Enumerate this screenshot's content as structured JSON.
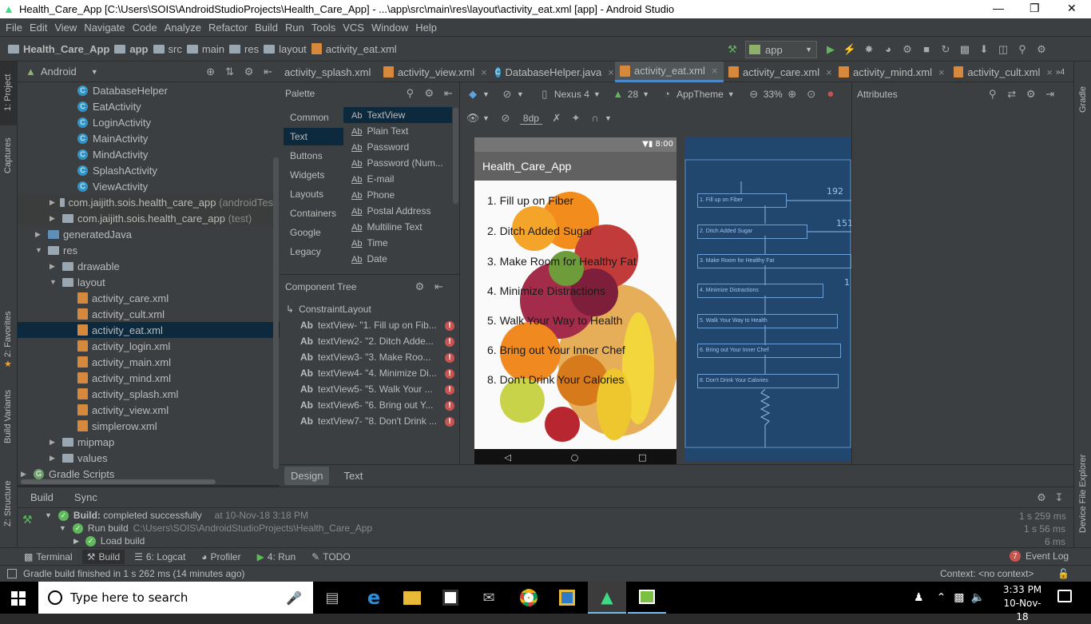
{
  "window": {
    "title": "Health_Care_App [C:\\Users\\SOIS\\AndroidStudioProjects\\Health_Care_App] - ...\\app\\src\\main\\res\\layout\\activity_eat.xml [app] - Android Studio"
  },
  "menu": [
    "File",
    "Edit",
    "View",
    "Navigate",
    "Code",
    "Analyze",
    "Refactor",
    "Build",
    "Run",
    "Tools",
    "VCS",
    "Window",
    "Help"
  ],
  "breadcrumbs": [
    "Health_Care_App",
    "app",
    "src",
    "main",
    "res",
    "layout",
    "activity_eat.xml"
  ],
  "run_config": "app",
  "project": {
    "view_mode": "Android",
    "items": [
      {
        "label": "DatabaseHelper",
        "kind": "class"
      },
      {
        "label": "EatActivity",
        "kind": "class"
      },
      {
        "label": "LoginActivity",
        "kind": "class"
      },
      {
        "label": "MainActivity",
        "kind": "class"
      },
      {
        "label": "MindActivity",
        "kind": "class"
      },
      {
        "label": "SplashActivity",
        "kind": "class"
      },
      {
        "label": "ViewActivity",
        "kind": "class"
      },
      {
        "label": "com.jaijith.sois.health_care_app",
        "suffix": "(androidTest)",
        "kind": "pkg"
      },
      {
        "label": "com.jaijith.sois.health_care_app",
        "suffix": "(test)",
        "kind": "pkg"
      },
      {
        "label": "generatedJava",
        "kind": "folder"
      },
      {
        "label": "res",
        "kind": "folder"
      },
      {
        "label": "drawable",
        "kind": "folder"
      },
      {
        "label": "layout",
        "kind": "folder"
      },
      {
        "label": "activity_care.xml",
        "kind": "xml"
      },
      {
        "label": "activity_cult.xml",
        "kind": "xml"
      },
      {
        "label": "activity_eat.xml",
        "kind": "xml"
      },
      {
        "label": "activity_login.xml",
        "kind": "xml"
      },
      {
        "label": "activity_main.xml",
        "kind": "xml"
      },
      {
        "label": "activity_mind.xml",
        "kind": "xml"
      },
      {
        "label": "activity_splash.xml",
        "kind": "xml"
      },
      {
        "label": "activity_view.xml",
        "kind": "xml"
      },
      {
        "label": "simplerow.xml",
        "kind": "xml"
      },
      {
        "label": "mipmap",
        "kind": "folder"
      },
      {
        "label": "values",
        "kind": "folder"
      },
      {
        "label": "Gradle Scripts",
        "kind": "gradle"
      }
    ]
  },
  "left_strip": [
    "1: Project",
    "Captures",
    "2: Favorites",
    "Build Variants",
    "Z: Structure"
  ],
  "right_strip": [
    "Gradle",
    "Device File Explorer"
  ],
  "editor_tabs": [
    "activity_splash.xml",
    "activity_view.xml",
    "DatabaseHelper.java",
    "activity_eat.xml",
    "activity_care.xml",
    "activity_mind.xml",
    "activity_cult.xml"
  ],
  "tab_overflow": "»4",
  "palette": {
    "title": "Palette",
    "categories": [
      "Common",
      "Text",
      "Buttons",
      "Widgets",
      "Layouts",
      "Containers",
      "Google",
      "Legacy"
    ],
    "items": [
      "TextView",
      "Plain Text",
      "Password",
      "Password (Num...",
      "E-mail",
      "Phone",
      "Postal Address",
      "Multiline Text",
      "Time",
      "Date"
    ]
  },
  "component_tree": {
    "title": "Component Tree",
    "root": "ConstraintLayout",
    "items": [
      "textView- \"1. Fill up on Fib...",
      "textView2- \"2. Ditch Adde...",
      "textView3- \"3. Make Roo...",
      "textView4- \"4. Minimize Di...",
      "textView5- \"5. Walk Your ...",
      "textView6- \"6. Bring out Y...",
      "textView7- \"8. Don't Drink ..."
    ]
  },
  "design_toolbar": {
    "device": "Nexus 4",
    "api": "28",
    "theme": "AppTheme",
    "zoom": "33%",
    "margin": "8dp"
  },
  "attributes": {
    "title": "Attributes"
  },
  "phone": {
    "time": "8:00",
    "app_title": "Health_Care_App",
    "items": [
      "1. Fill up on Fiber",
      "2. Ditch Added Sugar",
      "3. Make Room for Healthy Fat",
      "4. Minimize Distractions",
      "5. Walk Your Way to Health",
      "6. Bring out Your Inner Chef",
      "8. Don't Drink Your Calories"
    ]
  },
  "blueprint": {
    "items": [
      "1. Fill up on Fiber",
      "2. Ditch Added Sugar",
      "3. Make Room for Healthy Fat",
      "4. Minimize Distractions",
      "5. Walk Your Way to Health",
      "6. Bring out Your Inner Chef",
      "8. Don't Drink Your Calories"
    ],
    "dims": [
      "192",
      "151",
      "1"
    ]
  },
  "design_tabs": [
    "Design",
    "Text"
  ],
  "build": {
    "tabs": [
      "Build",
      "Sync"
    ],
    "line1_label": "Build:",
    "line1_status": "completed successfully",
    "line1_time": "at 10-Nov-18 3:18 PM",
    "line1_dur": "1 s 259 ms",
    "line2_label": "Run build",
    "line2_path": "C:\\Users\\SOIS\\AndroidStudioProjects\\Health_Care_App",
    "line2_dur": "1 s 56 ms",
    "line3_label": "Load build",
    "line3_dur": "6 ms"
  },
  "toolwindows": [
    "Terminal",
    "Build",
    "6: Logcat",
    "Profiler",
    "4: Run",
    "TODO"
  ],
  "event_log": {
    "count": "7",
    "label": "Event Log"
  },
  "status": {
    "message": "Gradle build finished in 1 s 262 ms (14 minutes ago)",
    "context": "Context: <no context>"
  },
  "taskbar": {
    "search_placeholder": "Type here to search",
    "time": "3:33 PM",
    "date": "10-Nov-18"
  },
  "colors": {
    "accent": "#4a88c7",
    "error": "#c75450",
    "success": "#5fb85b",
    "blueprint": "#22476e"
  }
}
